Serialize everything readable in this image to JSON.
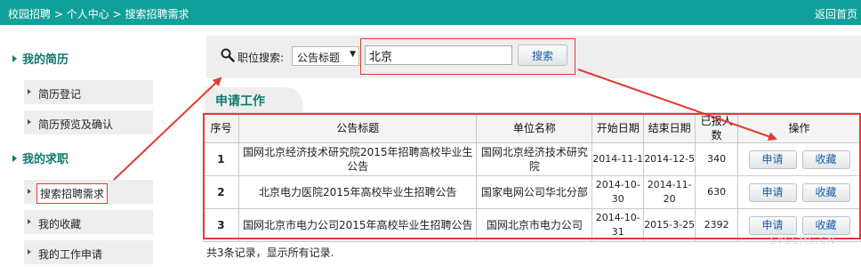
{
  "topbar": {
    "crumb_1": "校园招聘",
    "crumb_sep": ">",
    "crumb_2": "个人中心",
    "crumb_3": "搜索招聘需求",
    "home_link": "返回首页"
  },
  "sidebar": {
    "resume_heading": "我的简历",
    "resume_items": [
      "简历登记",
      "简历预览及确认"
    ],
    "job_heading": "我的求职",
    "job_items": [
      "搜索招聘需求",
      "我的收藏",
      "我的工作申请"
    ],
    "active_item": "搜索招聘需求"
  },
  "search": {
    "label": "职位搜索:",
    "field_select": "公告标题",
    "keyword": "北京",
    "button": "搜索",
    "icon": "magnifier-icon"
  },
  "tab": {
    "label": "申请工作"
  },
  "table": {
    "headers": [
      "序号",
      "公告标题",
      "单位名称",
      "开始日期",
      "结束日期",
      "已报人数",
      "操作"
    ],
    "rows": [
      {
        "no": "1",
        "title": "国网北京经济技术研究院2015年招聘高校毕业生公告",
        "unit": "国网北京经济技术研究院",
        "start": "2014-11-1",
        "end": "2014-12-5",
        "count": "340"
      },
      {
        "no": "2",
        "title": "北京电力医院2015年高校毕业生招聘公告",
        "unit": "国家电网公司华北分部",
        "start": "2014-10-30",
        "end": "2014-11-20",
        "count": "630"
      },
      {
        "no": "3",
        "title": "国网北京市电力公司2015年高校毕业生招聘公告",
        "unit": "国网北京市电力公司",
        "start": "2014-10-31",
        "end": "2015-3-25",
        "count": "2392"
      }
    ],
    "apply_label": "申请",
    "fav_label": "收藏"
  },
  "footer": {
    "summary": "共3条记录，显示所有记录."
  },
  "watermark": "SYSCMS.CN",
  "colors": {
    "topbar": "#119f9a",
    "accent": "#0f7a6e",
    "annotation": "#e53935"
  }
}
